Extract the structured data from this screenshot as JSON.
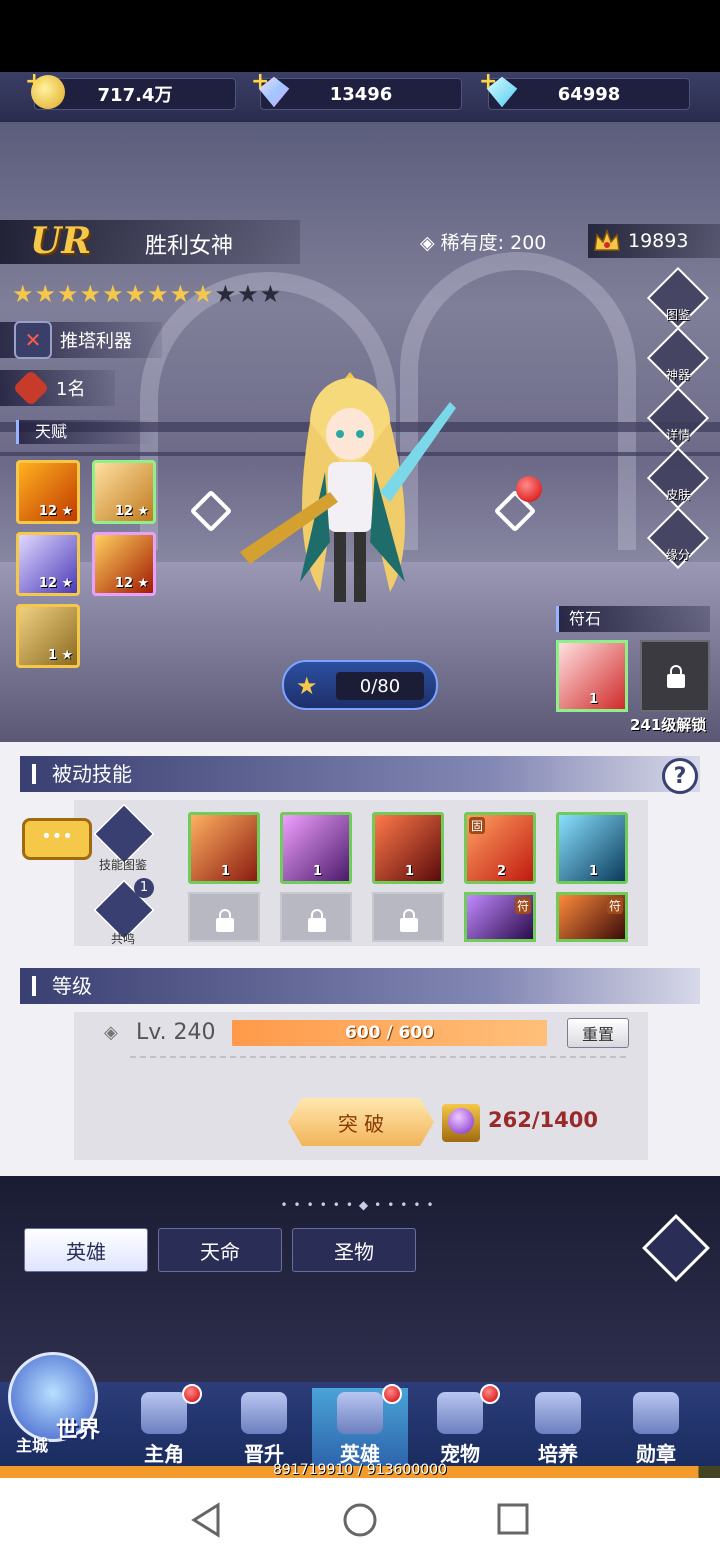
{
  "resources": [
    {
      "icon": "gold-coin-icon",
      "value": "717.4万"
    },
    {
      "icon": "crystal-icon",
      "value": "13496"
    },
    {
      "icon": "diamond-icon",
      "value": "64998"
    }
  ],
  "hero": {
    "rarity_grade": "UR",
    "name": "胜利女神",
    "rarity_label": "稀有度:",
    "rarity_value": "200",
    "power": "19893",
    "stars_filled": 9,
    "stars_total": 12,
    "role_tag": "推塔利器",
    "rank_tag": "1名"
  },
  "talent": {
    "label": "天赋",
    "slots": [
      {
        "level": "12"
      },
      {
        "level": "12"
      },
      {
        "level": "12"
      },
      {
        "level": "12"
      },
      {
        "level": "1"
      }
    ]
  },
  "side_menu": [
    {
      "label": "图鉴",
      "icon": "codex-icon"
    },
    {
      "label": "神器",
      "icon": "artifact-icon"
    },
    {
      "label": "详情",
      "icon": "details-icon"
    },
    {
      "label": "皮肤",
      "icon": "skin-icon"
    },
    {
      "label": "缘分",
      "icon": "bond-icon"
    }
  ],
  "rune": {
    "label": "符石",
    "slot_level": "1",
    "unlock_text": "241级解锁"
  },
  "exp": {
    "value": "0/80"
  },
  "passive": {
    "title": "被动技能",
    "help": "?",
    "codex_label": "技能图鉴",
    "resonance_label": "共鸣",
    "resonance_count": "1",
    "skills": [
      {
        "level": "1",
        "color": "#c8402a"
      },
      {
        "level": "1",
        "color": "#8a3ab8"
      },
      {
        "level": "1",
        "color": "#b81a1a"
      },
      {
        "level": "2",
        "color": "#e05a2a",
        "badge": "固"
      },
      {
        "level": "1",
        "color": "#2a8aa8"
      }
    ],
    "bottom_badge": "符"
  },
  "level": {
    "title": "等级",
    "lv_text": "Lv. 240",
    "progress_text": "600 / 600",
    "progress": 1.0,
    "reset_label": "重置",
    "break_label": "突 破",
    "orb_text": "262/1400"
  },
  "tabs": [
    {
      "label": "英雄",
      "active": true
    },
    {
      "label": "天命",
      "active": false
    },
    {
      "label": "圣物",
      "active": false
    }
  ],
  "nav": [
    {
      "label": "世界",
      "sub": "主城"
    },
    {
      "label": "主角",
      "dot": true
    },
    {
      "label": "晋升",
      "dot": false
    },
    {
      "label": "英雄",
      "dot": true,
      "active": true
    },
    {
      "label": "宠物",
      "dot": true
    },
    {
      "label": "培养",
      "dot": false
    },
    {
      "label": "勋章",
      "dot": false
    }
  ],
  "player_exp": "891719910 / 913600000",
  "colors": {
    "accent_gold": "#f5c84a",
    "red_dot": "#d40000",
    "exp_orange": "#ff9a4a"
  }
}
